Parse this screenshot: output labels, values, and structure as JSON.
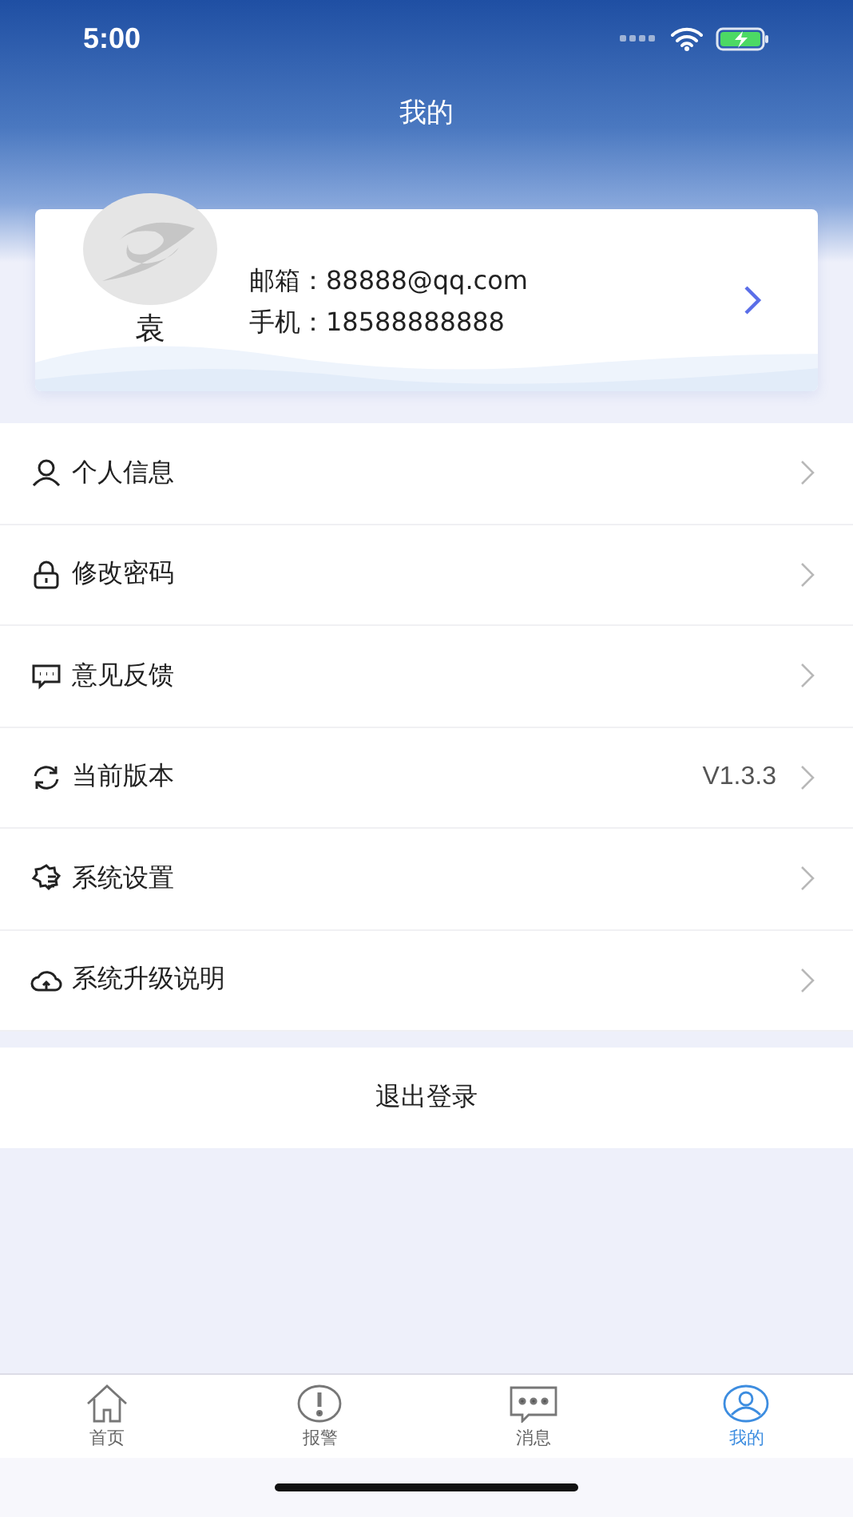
{
  "status_bar": {
    "time": "5:00"
  },
  "header": {
    "title": "我的"
  },
  "profile": {
    "name": "袁",
    "email_label": "邮箱：",
    "email": "88888@qq.com",
    "phone_label": "手机：",
    "phone": "18588888888"
  },
  "menu": [
    {
      "kind": "user",
      "label": "个人信息"
    },
    {
      "kind": "lock",
      "label": "修改密码"
    },
    {
      "kind": "chat",
      "label": "意见反馈"
    },
    {
      "kind": "sync",
      "label": "当前版本",
      "value": "V1.3.3"
    },
    {
      "kind": "gear",
      "label": "系统设置"
    },
    {
      "kind": "cloud",
      "label": "系统升级说明"
    }
  ],
  "logout": "退出登录",
  "tabs": [
    {
      "kind": "home",
      "label": "首页",
      "selected": false
    },
    {
      "kind": "alert",
      "label": "报警",
      "selected": false
    },
    {
      "kind": "message",
      "label": "消息",
      "selected": false
    },
    {
      "kind": "me",
      "label": "我的",
      "selected": true
    }
  ]
}
